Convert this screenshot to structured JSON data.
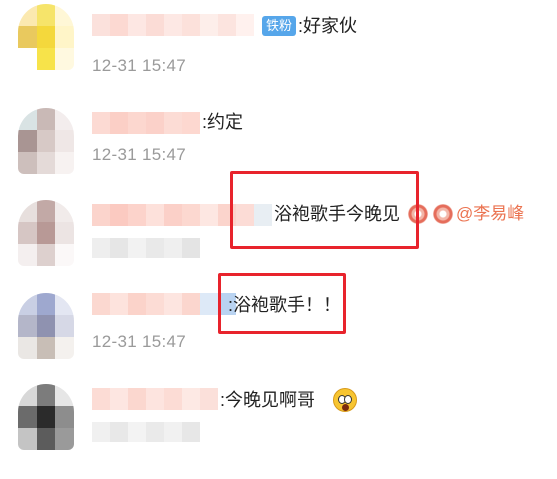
{
  "comments": [
    {
      "badge": "铁粉",
      "text": ":好家伙",
      "time": "12-31 15:47"
    },
    {
      "text": ":约定",
      "time": "12-31 15:47"
    },
    {
      "text": "浴袍歌手今晚见",
      "mention": "@李易峰",
      "emojis": [
        "flower-icon",
        "flower-icon"
      ]
    },
    {
      "text": ":浴袍歌手！！",
      "time": "12-31 15:47"
    },
    {
      "text": ":今晚见啊哥",
      "emojis": [
        "shocked-face-icon"
      ]
    }
  ],
  "colors": {
    "highlight_box": "#e8232c",
    "mention": "#eb7350",
    "badge": "#56a6ea",
    "timestamp": "#9a9a9a"
  }
}
